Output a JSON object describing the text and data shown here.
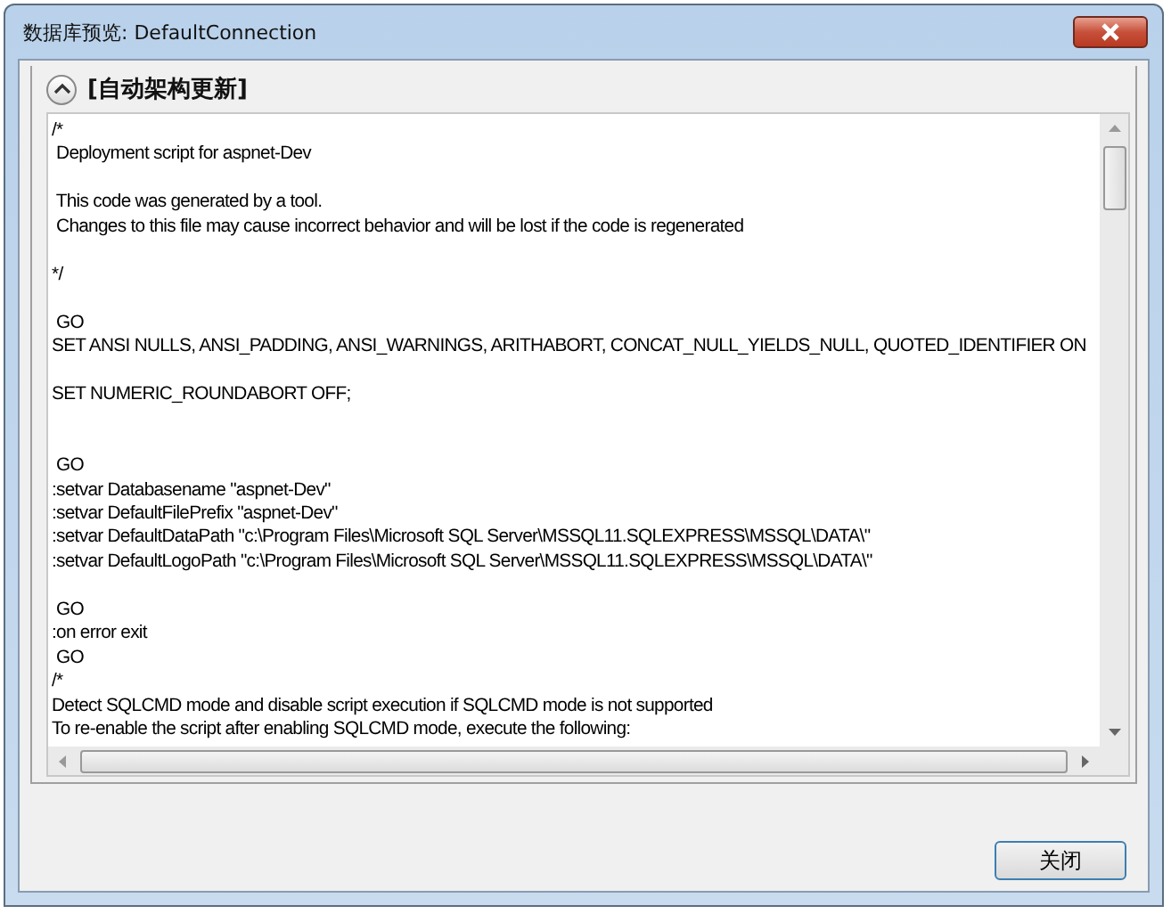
{
  "window": {
    "title": "数据库预览: DefaultConnection"
  },
  "section": {
    "title": "[自动架构更新]",
    "expanded": true
  },
  "script_blocks": [
    {
      "kind": "code",
      "lines": [
        "/*",
        " Deployment script for aspnet-Dev"
      ]
    },
    {
      "kind": "blank"
    },
    {
      "kind": "code",
      "lines": [
        " This code was generated by a tool.",
        " Changes to this file may cause incorrect behavior and will be lost if the code is regenerated"
      ]
    },
    {
      "kind": "blank"
    },
    {
      "kind": "code",
      "lines": [
        "*/"
      ]
    },
    {
      "kind": "blank"
    },
    {
      "kind": "code",
      "lines": [
        " GO",
        "SET ANSI NULLS, ANSI_PADDING, ANSI_WARNINGS, ARITHABORT, CONCAT_NULL_YIELDS_NULL, QUOTED_IDENTIFIER ON"
      ]
    },
    {
      "kind": "blank"
    },
    {
      "kind": "code",
      "lines": [
        "SET NUMERIC_ROUNDABORT OFF;"
      ]
    },
    {
      "kind": "blank"
    },
    {
      "kind": "blank"
    },
    {
      "kind": "code",
      "lines": [
        " GO",
        ":setvar Databasename \"aspnet-Dev\"",
        ":setvar DefaultFilePrefix \"aspnet-Dev\"",
        ":setvar DefaultDataPath \"c:\\Program Files\\Microsoft SQL Server\\MSSQL11.SQLEXPRESS\\MSSQL\\DATA\\\"",
        ":setvar DefaultLogoPath \"c:\\Program Files\\Microsoft SQL Server\\MSSQL11.SQLEXPRESS\\MSSQL\\DATA\\\""
      ]
    },
    {
      "kind": "blank"
    },
    {
      "kind": "code",
      "lines": [
        " GO",
        ":on error exit",
        " GO",
        "/*",
        "Detect SQLCMD mode and disable script execution if SQLCMD mode is not supported",
        "To re-enable the script after enabling SQLCMD mode, execute the following:"
      ]
    }
  ],
  "buttons": [
    {
      "label": "关闭"
    }
  ]
}
